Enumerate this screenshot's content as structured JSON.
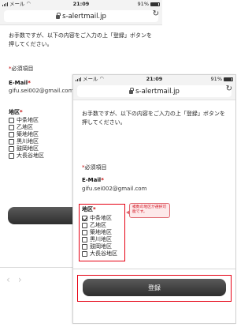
{
  "status_bar": {
    "carrier": "メール",
    "time": "21:09",
    "battery": "91%",
    "battery_level": 0.91
  },
  "browser": {
    "url": "s-alertmail.jp",
    "reload_icon": "reload-icon",
    "lock_icon": "lock-icon"
  },
  "form": {
    "intro": "お手数ですが、以下の内容をご入力の上「登録」ボタンを押してください。",
    "required_mark": "*",
    "required_note": "必須項目",
    "email_label": "E-Mail",
    "email_value": "gifu.sei002@gmail.com",
    "area_label": "地区",
    "areas": [
      {
        "label": "中条地区",
        "checked_back": false,
        "checked_front": true
      },
      {
        "label": "乙地区",
        "checked_back": false,
        "checked_front": false
      },
      {
        "label": "築地地区",
        "checked_back": false,
        "checked_front": false
      },
      {
        "label": "黒川地区",
        "checked_back": false,
        "checked_front": false
      },
      {
        "label": "鼓岡地区",
        "checked_back": false,
        "checked_front": false
      },
      {
        "label": "大長谷地区",
        "checked_back": false,
        "checked_front": false
      }
    ],
    "submit_label": "登録",
    "callout_text": "複数の地区が選択可能です。"
  },
  "colors": {
    "required": "#c00000",
    "highlight": "#e60012",
    "callout_bg": "#fde9ea",
    "button_dark": "#2e2e2e"
  }
}
